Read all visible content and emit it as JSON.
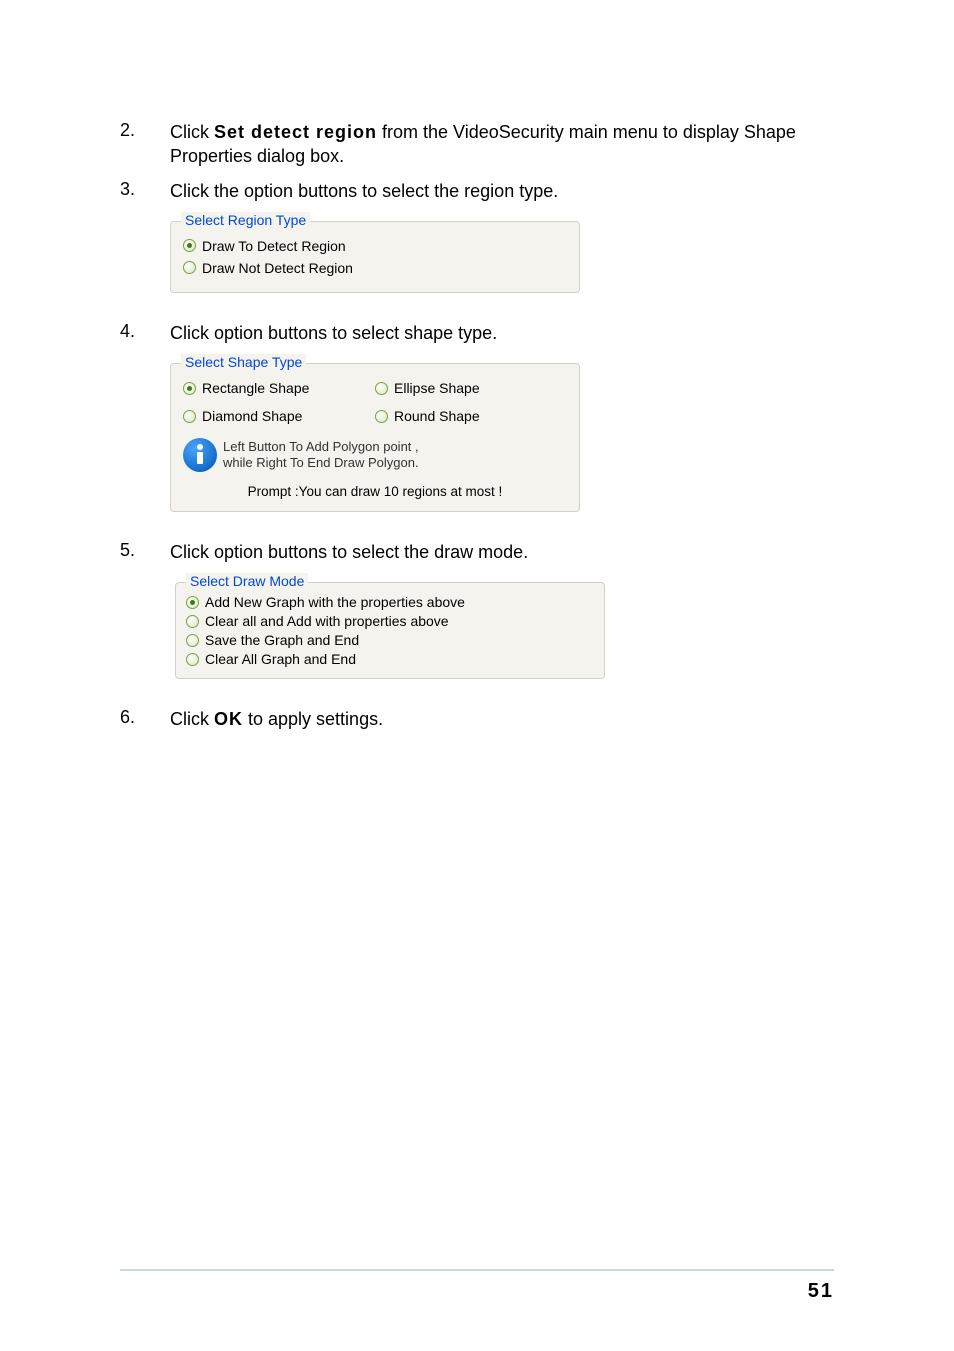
{
  "steps": {
    "s2": {
      "num": "2.",
      "pre": "Click ",
      "bold": "Set detect region",
      "post": " from the VideoSecurity main menu to display Shape Properties dialog box."
    },
    "s3": {
      "num": "3.",
      "text": "Click the option buttons to select the region type."
    },
    "s4": {
      "num": "4.",
      "text": "Click option buttons to select shape type."
    },
    "s5": {
      "num": "5.",
      "text": "Click option buttons to select the draw mode."
    },
    "s6": {
      "num": "6.",
      "pre": "Click ",
      "bold": "OK",
      "post": " to apply settings."
    }
  },
  "regionBox": {
    "legend": "Select Region Type",
    "opt1": "Draw To  Detect Region",
    "opt2": "Draw Not Detect Region"
  },
  "shapeBox": {
    "legend": "Select Shape Type",
    "opt1": "Rectangle Shape",
    "opt2": "Ellipse Shape",
    "opt3": "Diamond Shape",
    "opt4": "Round Shape",
    "info1": "Left  Button To Add Polygon point ,",
    "info2": "while Right To End Draw Polygon.",
    "prompt": "Prompt :You can draw 10 regions at most !"
  },
  "modeBox": {
    "legend": "Select Draw Mode",
    "opt1": "Add New Graph with the properties above",
    "opt2": "Clear all and Add with properties above",
    "opt3": "Save the Graph and End",
    "opt4": "Clear All Graph and End"
  },
  "pageNumber": "51"
}
